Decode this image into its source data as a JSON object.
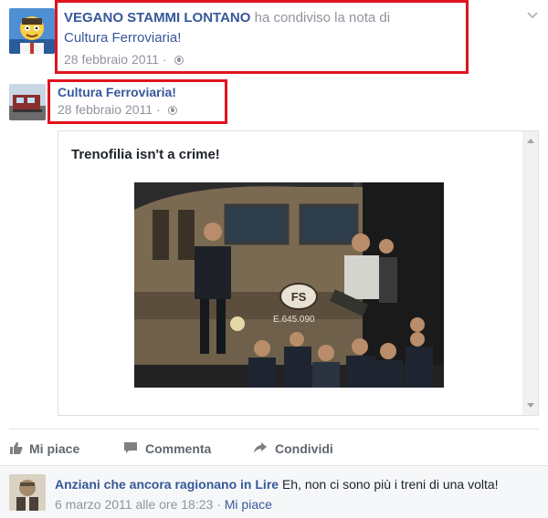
{
  "share": {
    "author": "VEGANO STAMMI LONTANO",
    "action_text": "ha condiviso la",
    "note_word": "nota",
    "of_word": "di",
    "target": "Cultura Ferroviaria!",
    "date": "28 febbraio 2011",
    "separator": "·",
    "privacy_icon": "globe-icon"
  },
  "original": {
    "author": "Cultura Ferroviaria!",
    "date": "28 febbraio 2011",
    "separator": "·",
    "privacy_icon": "globe-icon"
  },
  "note": {
    "title": "Trenofilia isn't a crime!",
    "locomotive_number": "E.645.090",
    "logo_text": "FS"
  },
  "actions": {
    "like": "Mi piace",
    "comment": "Commenta",
    "share": "Condividi"
  },
  "comment": {
    "author": "Anziani che ancora ragionano in Lire",
    "text": "Eh, non ci sono più i treni di una volta!",
    "time": "6 marzo 2011 alle ore 18:23",
    "separator": "·",
    "like": "Mi piace"
  },
  "colors": {
    "link": "#365899",
    "highlight": "#e0141e",
    "meta": "#90949c"
  }
}
